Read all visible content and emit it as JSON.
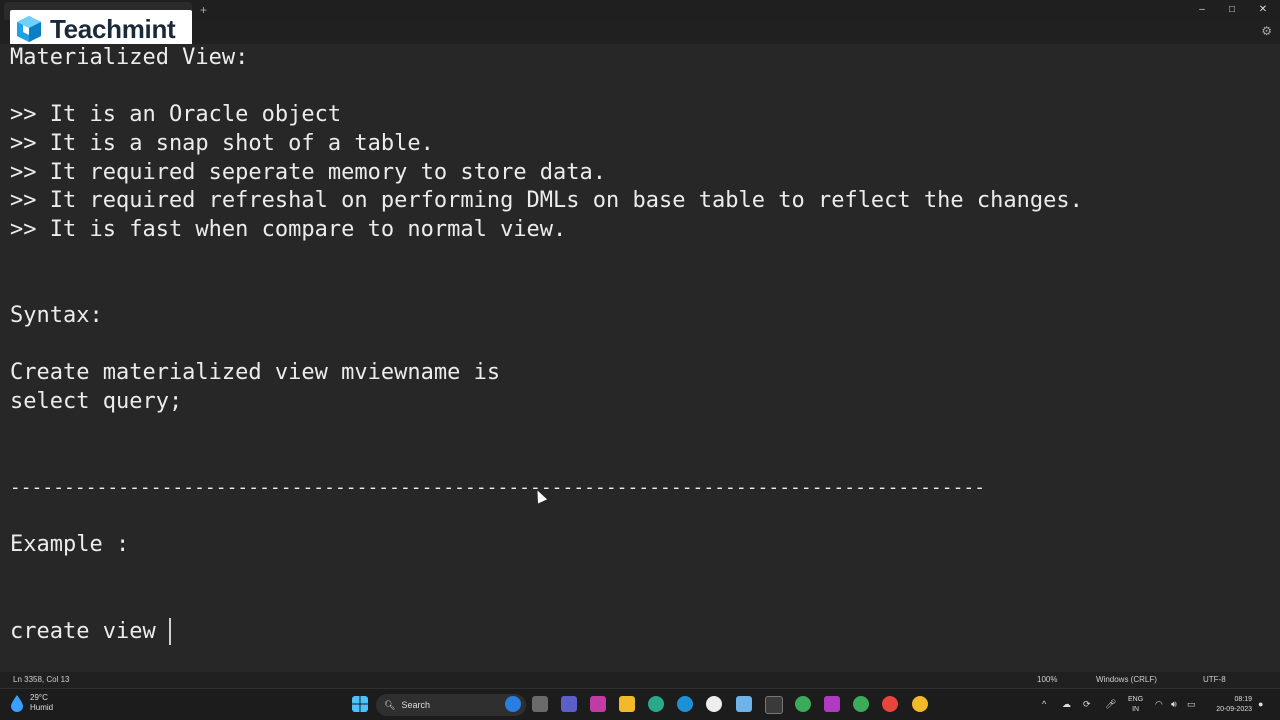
{
  "window": {
    "new_tab_symbol": "+",
    "controls": {
      "minimize": "–",
      "maximize": "□",
      "close": "✕"
    },
    "settings_icon": "gear-icon"
  },
  "logo": {
    "text": "Teachmint",
    "brand_color": "#1da1e8"
  },
  "editor": {
    "lines": [
      "Materialized View:",
      "",
      ">> It is an Oracle object",
      ">> It is a snap shot of a table.",
      ">> It required seperate memory to store data.",
      ">> It required refreshal on performing DMLs on base table to reflect the changes.",
      ">> It is fast when compare to normal view.",
      "",
      "",
      "Syntax:",
      "",
      "Create materialized view mviewname is",
      "select query;",
      "",
      "",
      "------------------------------------------------------------------------------------------",
      "",
      "Example :",
      "",
      "",
      "create view "
    ]
  },
  "statusbar": {
    "position": "Ln 3358, Col 13",
    "zoom": "100%",
    "line_ending": "Windows (CRLF)",
    "encoding": "UTF-8"
  },
  "taskbar": {
    "weather_temp": "29°C",
    "weather_desc": "Humid",
    "search_label": "Search",
    "lang_top": "ENG",
    "lang_bottom": "IN",
    "time": "08:19",
    "date": "20-09-2023",
    "chevron": "^"
  }
}
